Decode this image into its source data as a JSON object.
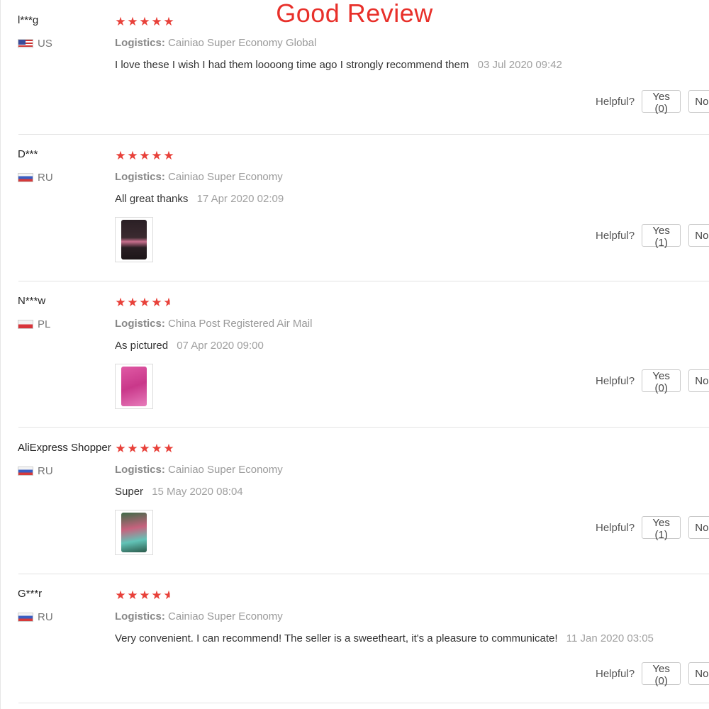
{
  "header": {
    "title": "Good Review"
  },
  "common": {
    "logistics_label": "Logistics:",
    "helpful_label": "Helpful?",
    "no_label": "No"
  },
  "reviews": [
    {
      "user": "l***g",
      "country": "US",
      "stars": 5,
      "logistics": "Cainiao Super Economy Global",
      "text": "I love these I wish I had them loooong time ago I strongly recommend them",
      "date": "03 Jul 2020 09:42",
      "yes": "Yes (0)"
    },
    {
      "user": "D***",
      "country": "RU",
      "stars": 5,
      "logistics": "Cainiao Super Economy",
      "text": "All great thanks",
      "date": "17 Apr 2020 02:09",
      "yes": "Yes (1)",
      "photo": "product-photo"
    },
    {
      "user": "N***w",
      "country": "PL",
      "stars": 4.5,
      "logistics": "China Post Registered Air Mail",
      "text": "As pictured",
      "date": "07 Apr 2020 09:00",
      "yes": "Yes (0)",
      "photo": "product-photo"
    },
    {
      "user": "AliExpress Shopper",
      "country": "RU",
      "stars": 5,
      "logistics": "Cainiao Super Economy",
      "text": "Super",
      "date": "15 May 2020 08:04",
      "yes": "Yes (1)",
      "photo": "product-photo"
    },
    {
      "user": "G***r",
      "country": "RU",
      "stars": 4.5,
      "logistics": "Cainiao Super Economy",
      "text": "Very convenient. I can recommend! The seller is a sweetheart, it's a pleasure to communicate!",
      "date": "11 Jan 2020 03:05",
      "yes": "Yes (0)"
    }
  ]
}
